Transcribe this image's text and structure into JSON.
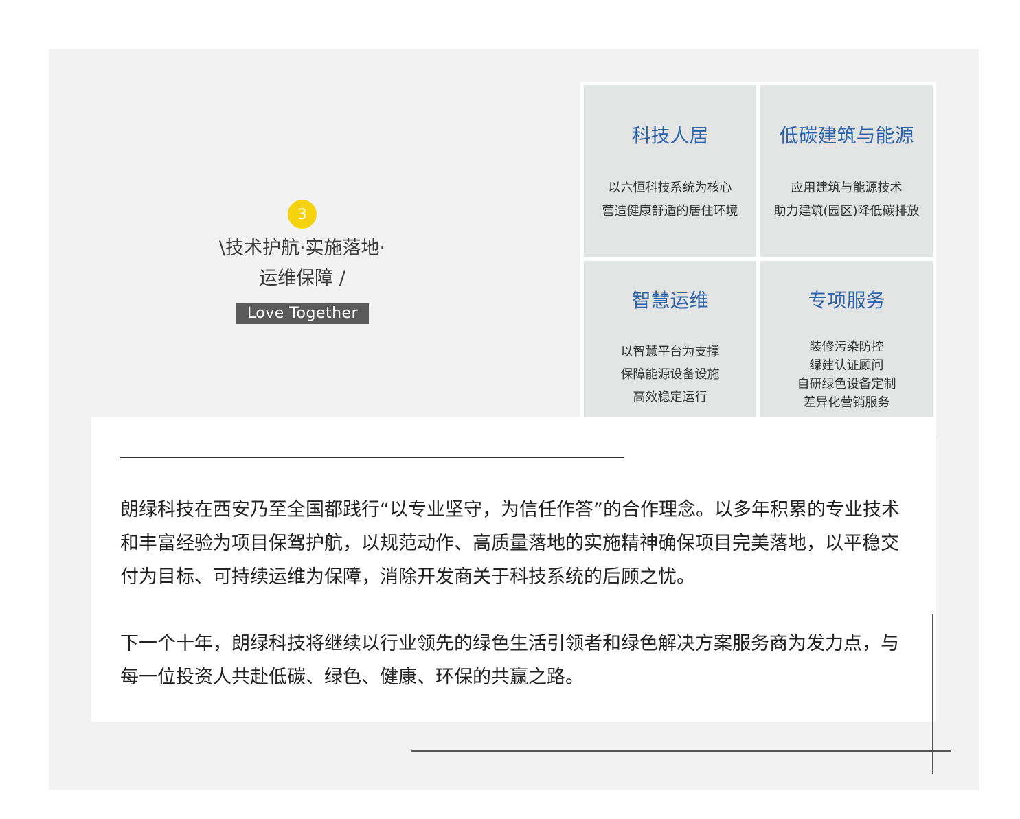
{
  "intro": {
    "number": "3",
    "heading_line1": "\\技术护航·实施落地·",
    "heading_line2": "运维保障 /",
    "tag": "Love Together"
  },
  "cards": [
    {
      "title": "科技人居",
      "lines": [
        "以六恒科技系统为核心",
        "营造健康舒适的居住环境"
      ]
    },
    {
      "title": "低碳建筑与能源",
      "lines": [
        "应用建筑与能源技术",
        "助力建筑(园区)降低碳排放"
      ]
    },
    {
      "title": "智慧运维",
      "lines": [
        "以智慧平台为支撑",
        "保障能源设备设施",
        "高效稳定运行"
      ]
    },
    {
      "title": "专项服务",
      "lines": [
        "装修污染防控",
        "绿建认证顾问",
        "自研绿色设备定制",
        "差异化营销服务"
      ]
    }
  ],
  "body": {
    "paragraph1": "朗绿科技在西安乃至全国都践行“以专业坚守，为信任作答”的合作理念。以多年积累的专业技术和丰富经验为项目保驾护航，以规范动作、高质量落地的实施精神确保项目完美落地，以平稳交付为目标、可持续运维为保障，消除开发商关于科技系统的后顾之忧。",
    "paragraph2": "下一个十年，朗绿科技将继续以行业领先的绿色生活引领者和绿色解决方案服务商为发力点，与每一位投资人共赴低碳、绿色、健康、环保的共赢之路。"
  },
  "colors": {
    "panel": "#f2f2f2",
    "card": "#e3e4e4",
    "title_blue": "#2f63a8",
    "badge": "#f5d20e",
    "tag_bg": "#5a5a5a"
  }
}
